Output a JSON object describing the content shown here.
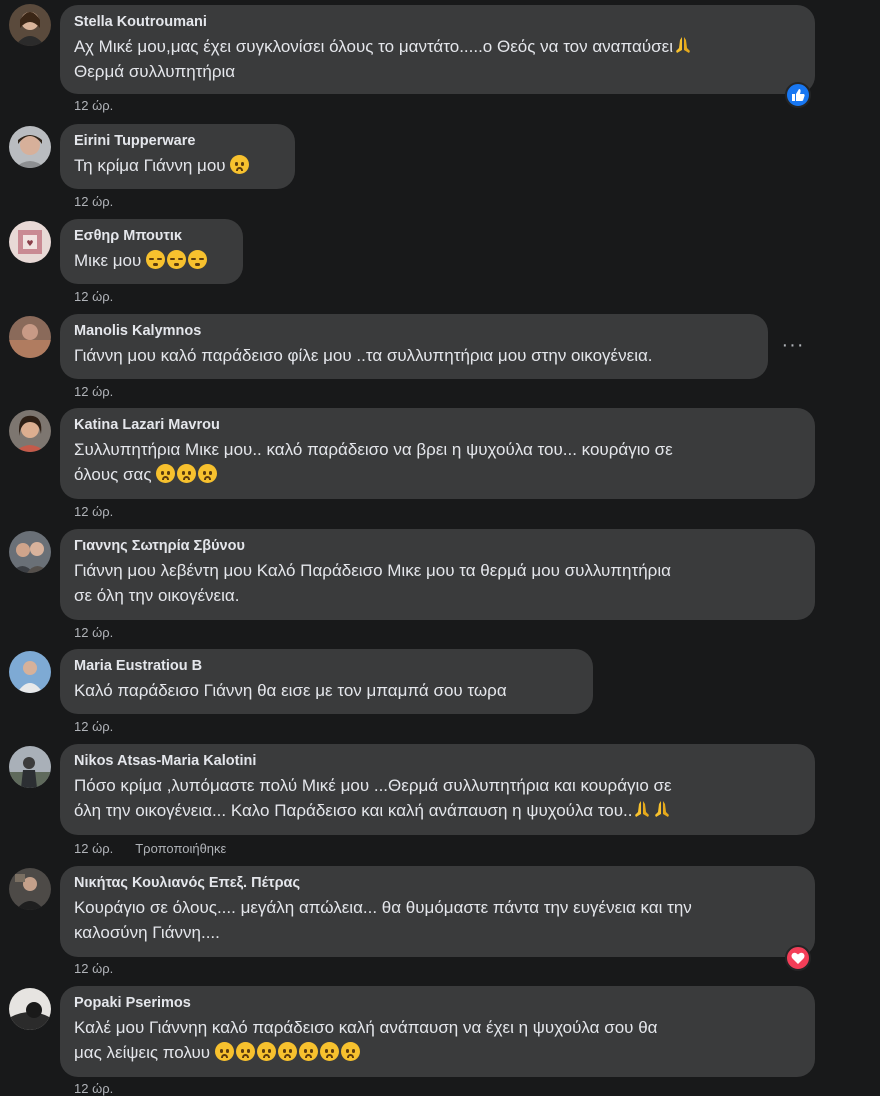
{
  "comments": [
    {
      "author": "Stella Koutroumani",
      "lines": [
        "Αχ Μικέ μου,μας έχει συγκλονίσει όλους το μαντάτο.....ο Θεός να τον αναπαύσει",
        "Θερμά συλλυπητήρια"
      ],
      "time": "12 ώρ.",
      "reaction": "like-icon"
    },
    {
      "author": "Eirini Tupperware",
      "lines": [
        "Τη κρίμα Γιάννη μου"
      ],
      "time": "12 ώρ."
    },
    {
      "author": "Εσθηρ Μπουτικ",
      "lines": [
        "Μικε μου"
      ],
      "time": "12 ώρ."
    },
    {
      "author": "Manolis Kalymnos",
      "lines": [
        "Γιάννη μου καλό παράδεισο φίλε μου ..τα συλλυπητήρια μου στην οικογένεια."
      ],
      "time": "12 ώρ.",
      "more": "···"
    },
    {
      "author": "Katina Lazari Mavrou",
      "lines": [
        "Συλλυπητήρια Μικε μου.. καλό παράδεισο να βρει η ψυχούλα του... κουράγιο σε",
        "όλους σας"
      ],
      "time": "12 ώρ."
    },
    {
      "author": "Γιαννης Σωτηρία Σβύνου",
      "lines": [
        "Γιάννη μου λεβέντη μου Καλό Παράδεισο Μικε μου τα θερμά μου συλλυπητήρια",
        "σε όλη την οικογένεια."
      ],
      "time": "12 ώρ."
    },
    {
      "author": "Maria Eustratiou B",
      "lines": [
        "Καλό παράδεισο Γιάννη θα εισε με τον μπαμπά σου τωρα"
      ],
      "time": "12 ώρ."
    },
    {
      "author": "Nikos Atsas-Maria Kalotini",
      "lines": [
        "Πόσο κρίμα ,λυπόμαστε πολύ Μικέ μου ...Θερμά συλλυπητήρια και κουράγιο σε",
        "όλη την οικογένεια... Καλο Παράδεισο και καλή ανάπαυση η ψυχούλα του.."
      ],
      "time": "12 ώρ.",
      "edited": "Τροποποιήθηκε"
    },
    {
      "author": "Νικήτας Κουλιανός Επεξ. Πέτρας",
      "lines": [
        "Κουράγιο σε όλους.... μεγάλη απώλεια... θα θυμόμαστε πάντα την ευγένεια και την",
        "καλοσύνη Γιάννη...."
      ],
      "time": "12 ώρ.",
      "reaction": "love-icon"
    },
    {
      "author": "Popaki Pserimos",
      "lines": [
        "Καλέ μου Γιάννηη καλό παράδεισο καλή ανάπαυση να έχει η ψυχούλα σου θα",
        "μας λείψεις πολυυ"
      ],
      "time": "12 ώρ."
    }
  ],
  "colors": {
    "background": "#18191a",
    "bubble": "#3a3b3c",
    "text": "#e4e6eb",
    "meta": "#b0b3b8",
    "like": "#1877f2",
    "love": "#f33e58"
  }
}
